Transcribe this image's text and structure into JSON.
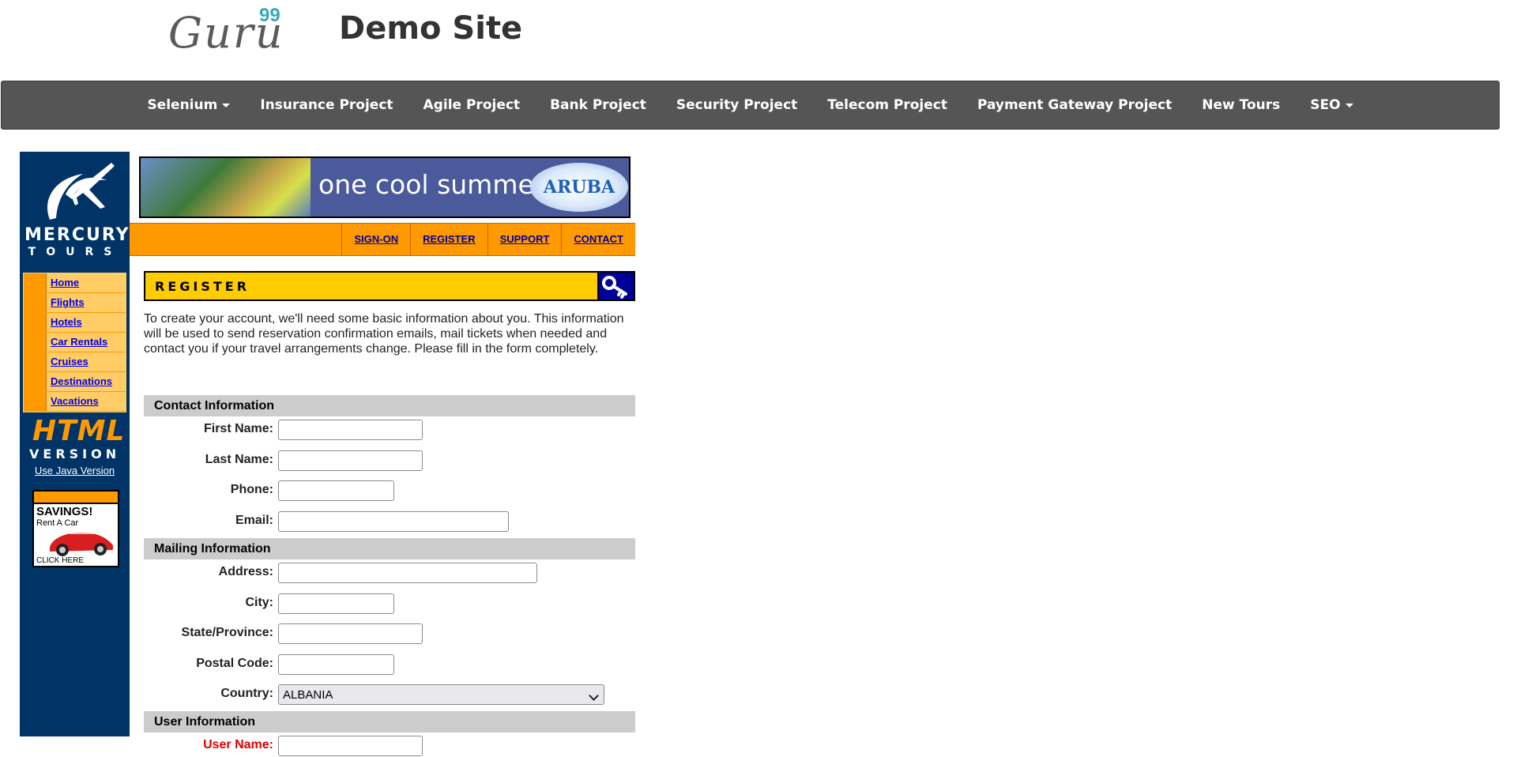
{
  "brand": {
    "logo_text": "Guru",
    "logo_sup": "99",
    "title": "Demo Site"
  },
  "nav": {
    "items": [
      {
        "label": "Selenium",
        "dropdown": true
      },
      {
        "label": "Insurance Project",
        "dropdown": false
      },
      {
        "label": "Agile Project",
        "dropdown": false
      },
      {
        "label": "Bank Project",
        "dropdown": false
      },
      {
        "label": "Security Project",
        "dropdown": false
      },
      {
        "label": "Telecom Project",
        "dropdown": false
      },
      {
        "label": "Payment Gateway Project",
        "dropdown": false
      },
      {
        "label": "New Tours",
        "dropdown": false
      },
      {
        "label": "SEO",
        "dropdown": true
      }
    ]
  },
  "mercury": {
    "logo_line1": "MERCURY",
    "logo_line2": "TOURS",
    "side_nav": [
      "Home",
      "Flights",
      "Hotels",
      "Car Rentals",
      "Cruises",
      "Destinations",
      "Vacations"
    ],
    "html_version_1": "HTML",
    "html_version_2": "VERSION",
    "java_link": "Use Java Version",
    "ad": {
      "line1": "SAVINGS!",
      "line2": "Rent A Car",
      "line3": "CLICK HERE"
    },
    "banner": {
      "text": "one cool summer",
      "brand": "ARUBA"
    },
    "top_nav": [
      "SIGN-ON",
      "REGISTER",
      "SUPPORT",
      "CONTACT"
    ]
  },
  "register": {
    "heading": "REGISTER",
    "intro": "To create your account, we'll need some basic information about you. This information will be used to send reservation confirmation emails, mail tickets when needed and contact you if your travel arrangements change. Please fill in the form completely.",
    "sections": {
      "contact": "Contact Information",
      "mailing": "Mailing Information",
      "user": "User Information"
    },
    "fields": {
      "first_name": {
        "label": "First Name:",
        "value": ""
      },
      "last_name": {
        "label": "Last Name:",
        "value": ""
      },
      "phone": {
        "label": "Phone:",
        "value": ""
      },
      "email": {
        "label": "Email:",
        "value": ""
      },
      "address": {
        "label": "Address:",
        "value": ""
      },
      "city": {
        "label": "City:",
        "value": ""
      },
      "state": {
        "label": "State/Province:",
        "value": ""
      },
      "postal": {
        "label": "Postal Code:",
        "value": ""
      },
      "country": {
        "label": "Country:",
        "selected": "ALBANIA"
      },
      "user_name": {
        "label": "User Name:",
        "value": ""
      }
    }
  },
  "colors": {
    "navbar_bg": "#555555",
    "mt_navy": "#003366",
    "mt_orange": "#ff9900",
    "mt_light_orange": "#ffcc66",
    "register_yellow": "#ffcc00",
    "section_gray": "#cccccc",
    "logo_teal": "#3aa6b9"
  }
}
